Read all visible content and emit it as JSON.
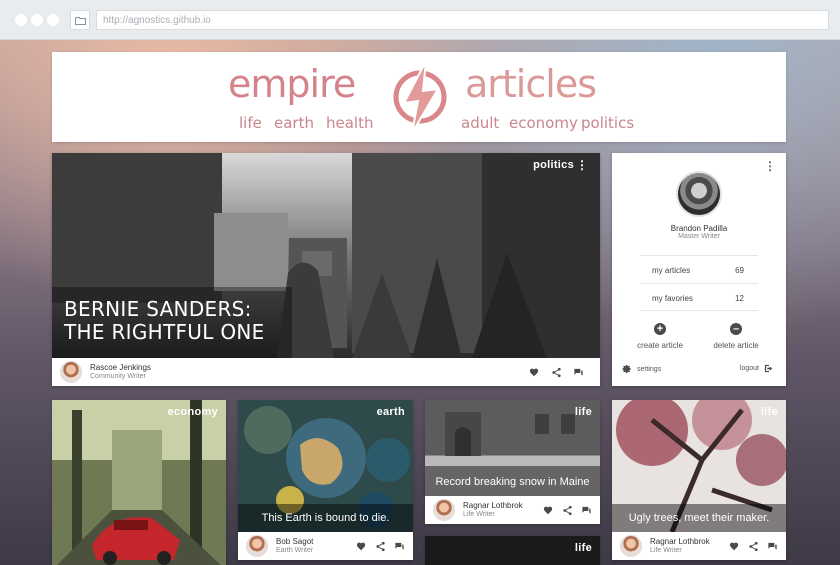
{
  "browser": {
    "url": "http://agnostics.github.io"
  },
  "header": {
    "brand_left": "empire",
    "brand_right": "articles",
    "categories_left": [
      "life",
      "earth",
      "health"
    ],
    "categories_right": [
      "adult",
      "economy",
      "politics"
    ]
  },
  "featured": {
    "category": "politics",
    "title_line1": "BERNIE SANDERS:",
    "title_line2": "THE RIGHTFUL ONE",
    "author": "Rascoe Jenkings",
    "role": "Community Writer"
  },
  "profile": {
    "name": "Brandon Padilla",
    "role": "Master Writer",
    "my_articles_label": "my articles",
    "my_articles_count": "69",
    "my_favorites_label": "my favories",
    "my_favorites_count": "12",
    "create_label": "create article",
    "delete_label": "delete article",
    "settings_label": "settings",
    "logout_label": "logout"
  },
  "cards": [
    {
      "category": "economy"
    },
    {
      "category": "earth",
      "headline": "This Earth is bound to die.",
      "author": "Bob Sagot",
      "role": "Earth Writer"
    },
    {
      "category": "life",
      "headline": "Record breaking snow in Maine",
      "author": "Ragnar Lothbrok",
      "role": "Life Writer"
    },
    {
      "category": "life"
    },
    {
      "category": "life",
      "headline": "Ugly trees, meet their maker.",
      "author": "Ragnar Lothbrok",
      "role": "Life Writer"
    }
  ],
  "icons": [
    "folder-icon",
    "heart-icon",
    "share-icon",
    "comment-icon",
    "gear-icon",
    "logout-icon",
    "plus-icon",
    "minus-icon",
    "more-icon"
  ]
}
